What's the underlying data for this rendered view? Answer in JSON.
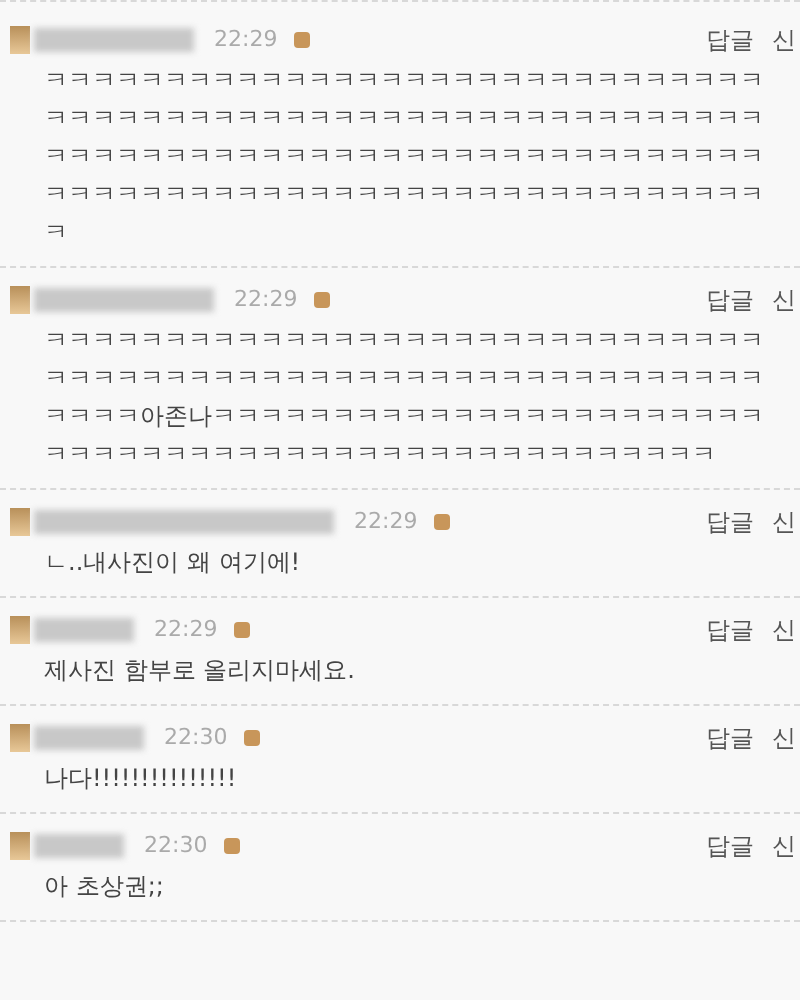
{
  "comments": [
    {
      "time": "22:29",
      "actions": [
        "답글",
        "신"
      ],
      "lines": [
        "ㅋㅋㅋㅋㅋㅋㅋㅋㅋㅋㅋㅋㅋㅋㅋㅋㅋㅋㅋㅋㅋㅋㅋㅋㅋㅋㅋㅋㅋㅋ",
        "ㅋㅋㅋㅋㅋㅋㅋㅋㅋㅋㅋㅋㅋㅋㅋㅋㅋㅋㅋㅋㅋㅋㅋㅋㅋㅋㅋㅋㅋㅋ",
        "ㅋㅋㅋㅋㅋㅋㅋㅋㅋㅋㅋㅋㅋㅋㅋㅋㅋㅋㅋㅋㅋㅋㅋㅋㅋㅋㅋㅋㅋㅋ",
        "ㅋㅋㅋㅋㅋㅋㅋㅋㅋㅋㅋㅋㅋㅋㅋㅋㅋㅋㅋㅋㅋㅋㅋㅋㅋㅋㅋㅋㅋㅋ",
        "ㅋ"
      ]
    },
    {
      "time": "22:29",
      "actions": [
        "답글",
        "신"
      ],
      "lines": [
        "ㅋㅋㅋㅋㅋㅋㅋㅋㅋㅋㅋㅋㅋㅋㅋㅋㅋㅋㅋㅋㅋㅋㅋㅋㅋㅋㅋㅋㅋㅋ",
        "ㅋㅋㅋㅋㅋㅋㅋㅋㅋㅋㅋㅋㅋㅋㅋㅋㅋㅋㅋㅋㅋㅋㅋㅋㅋㅋㅋㅋㅋㅋ",
        "ㅋㅋㅋㅋ아존나ㅋㅋㅋㅋㅋㅋㅋㅋㅋㅋㅋㅋㅋㅋㅋㅋㅋㅋㅋㅋㅋㅋㅋ",
        "ㅋㅋㅋㅋㅋㅋㅋㅋㅋㅋㅋㅋㅋㅋㅋㅋㅋㅋㅋㅋㅋㅋㅋㅋㅋㅋㅋㅋ"
      ]
    },
    {
      "time": "22:29",
      "actions": [
        "답글",
        "신"
      ],
      "lines": [
        "ㄴ..내사진이 왜 여기에!"
      ]
    },
    {
      "time": "22:29",
      "actions": [
        "답글",
        "신"
      ],
      "lines": [
        "제사진 함부로 올리지마세요."
      ]
    },
    {
      "time": "22:30",
      "actions": [
        "답글",
        "신"
      ],
      "lines": [
        "나다!!!!!!!!!!!!!!!"
      ]
    },
    {
      "time": "22:30",
      "actions": [
        "답글",
        "신"
      ],
      "lines": [
        "아 초상권;;"
      ]
    }
  ]
}
